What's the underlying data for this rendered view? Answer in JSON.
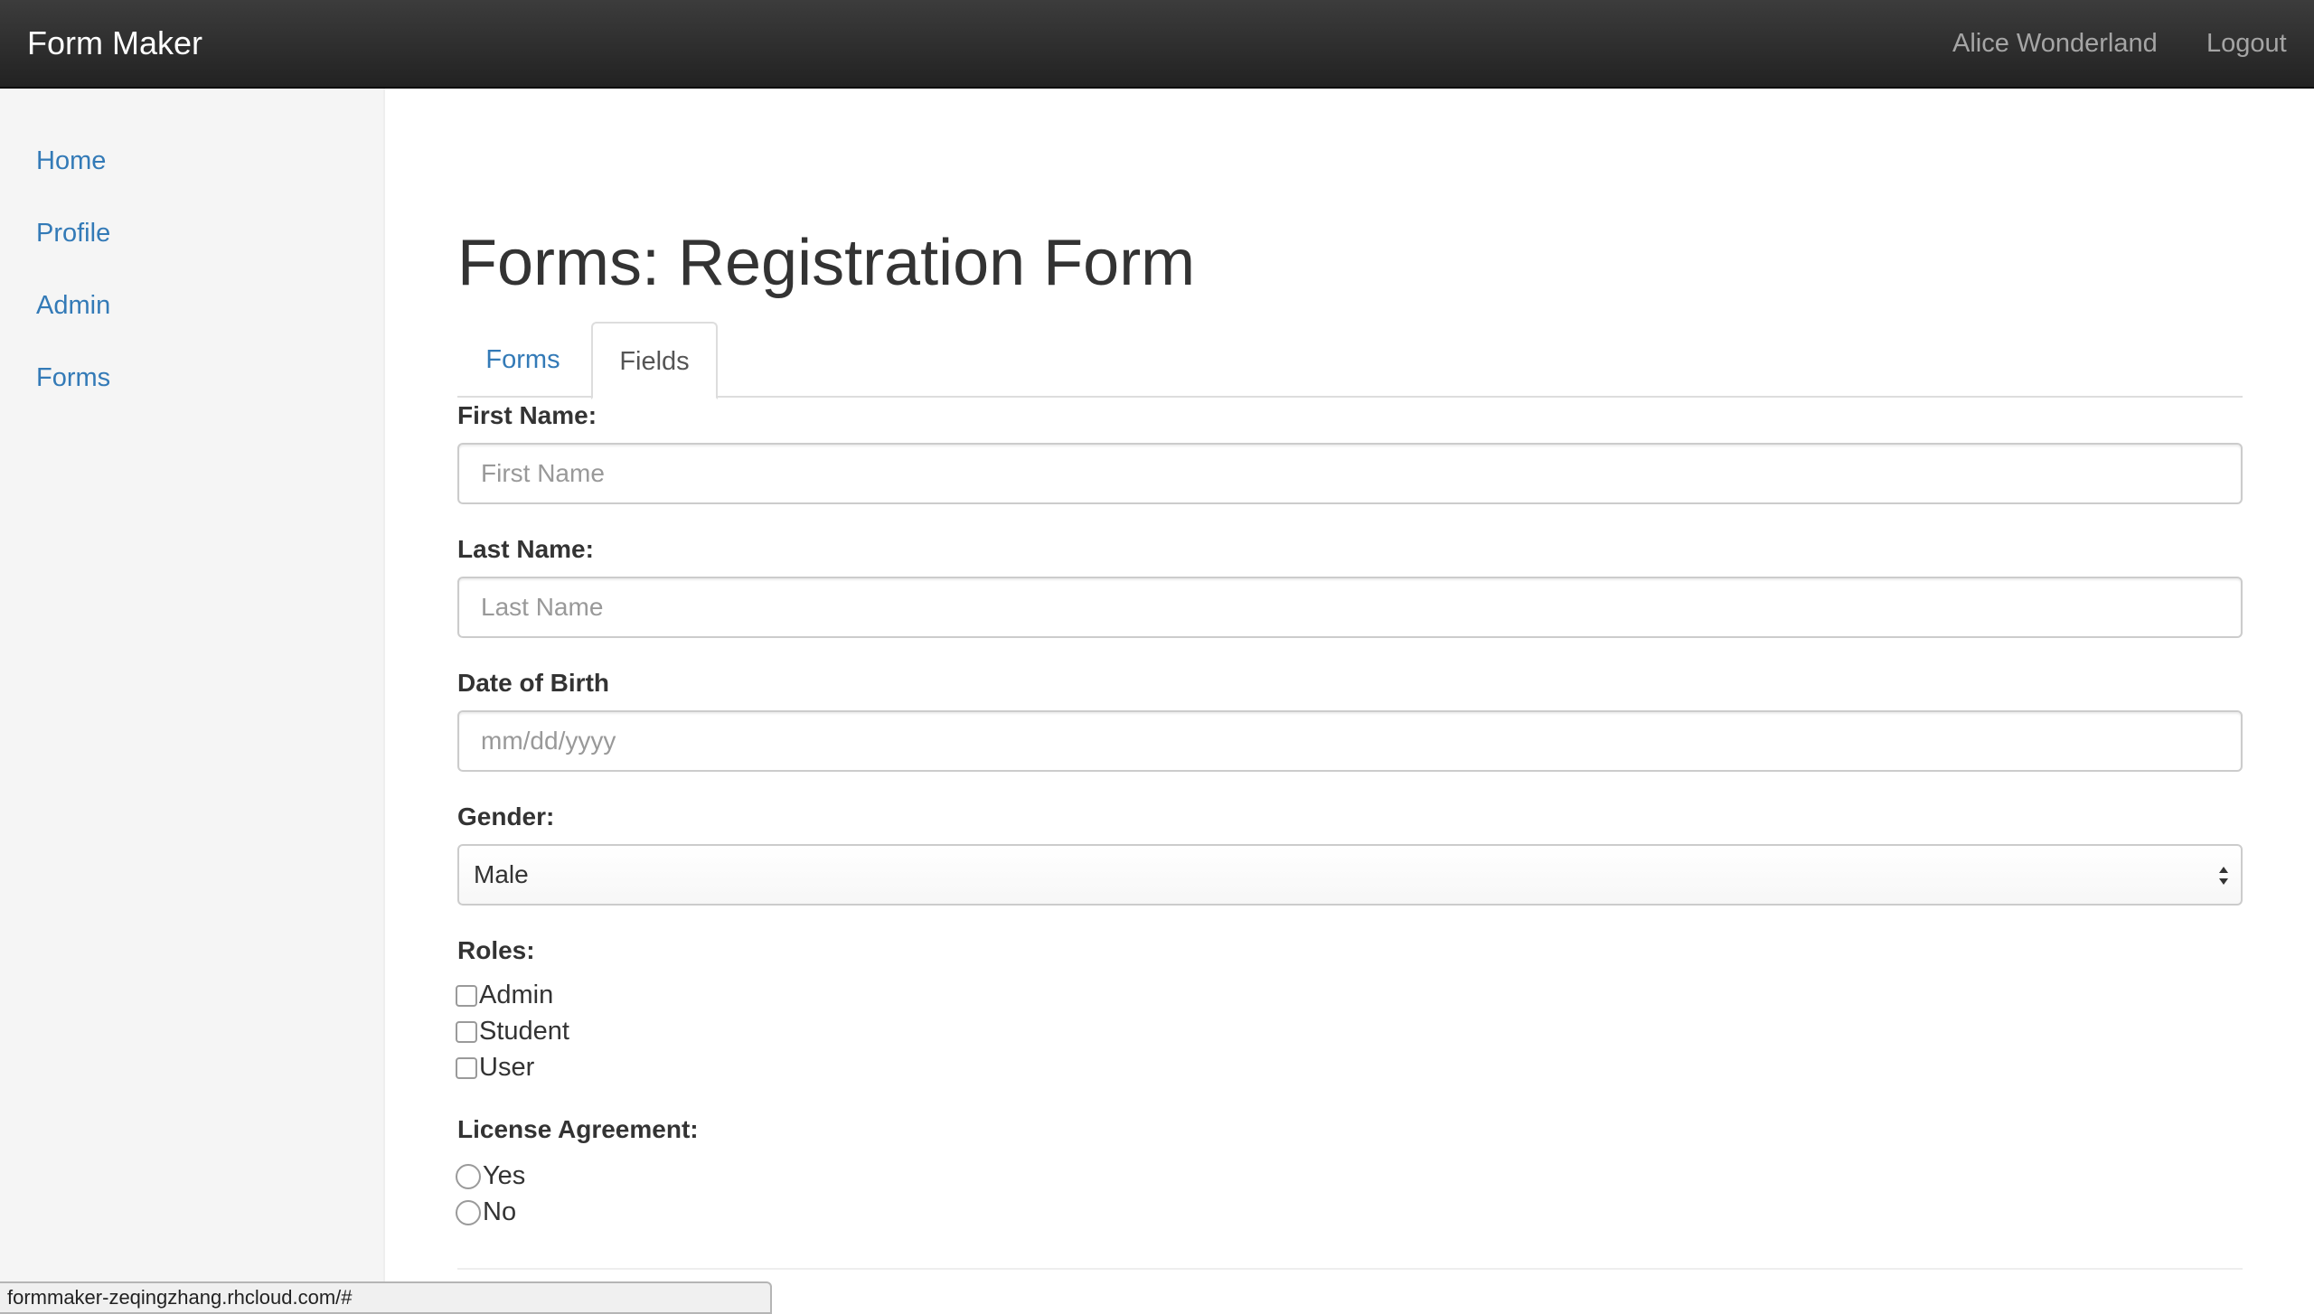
{
  "navbar": {
    "brand": "Form Maker",
    "user": "Alice Wonderland",
    "logout": "Logout"
  },
  "sidebar": {
    "items": [
      {
        "label": "Home"
      },
      {
        "label": "Profile"
      },
      {
        "label": "Admin"
      },
      {
        "label": "Forms"
      }
    ]
  },
  "main": {
    "title": "Forms: Registration Form",
    "tabs": [
      {
        "label": "Forms",
        "active": false
      },
      {
        "label": "Fields",
        "active": true
      }
    ],
    "fields": {
      "first_name": {
        "label": "First Name:",
        "placeholder": "First Name",
        "value": ""
      },
      "last_name": {
        "label": "Last Name:",
        "placeholder": "Last Name",
        "value": ""
      },
      "dob": {
        "label": "Date of Birth",
        "placeholder": "mm/dd/yyyy",
        "value": ""
      },
      "gender": {
        "label": "Gender:",
        "selected": "Male"
      },
      "roles": {
        "label": "Roles:",
        "options": [
          {
            "label": "Admin",
            "checked": false
          },
          {
            "label": "Student",
            "checked": false
          },
          {
            "label": "User",
            "checked": false
          }
        ]
      },
      "license": {
        "label": "License Agreement:",
        "options": [
          {
            "label": "Yes",
            "selected": false
          },
          {
            "label": "No",
            "selected": false
          }
        ]
      }
    }
  },
  "statusbar": {
    "url": "formmaker-zeqingzhang.rhcloud.com/#"
  },
  "colors": {
    "link": "#337ab7",
    "navbar": "#222222",
    "sidebar_bg": "#f5f5f5"
  }
}
